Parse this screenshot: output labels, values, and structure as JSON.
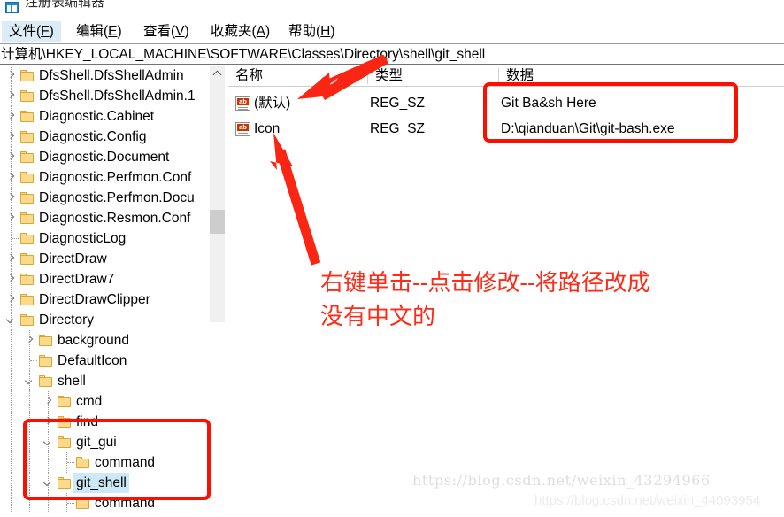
{
  "window": {
    "title": "注册表编辑器",
    "icon": "registry-editor-icon"
  },
  "menubar": {
    "items": [
      {
        "label": "文件(F)",
        "text": "文件(",
        "mnemonic": "F",
        "tail": ")",
        "active": true
      },
      {
        "label": "编辑(E)",
        "text": "编辑(",
        "mnemonic": "E",
        "tail": ")",
        "active": false
      },
      {
        "label": "查看(V)",
        "text": "查看(",
        "mnemonic": "V",
        "tail": ")",
        "active": false
      },
      {
        "label": "收藏夹(A)",
        "text": "收藏夹(",
        "mnemonic": "A",
        "tail": ")",
        "active": false
      },
      {
        "label": "帮助(H)",
        "text": "帮助(",
        "mnemonic": "H",
        "tail": ")",
        "active": false
      }
    ]
  },
  "address": {
    "path": "计算机\\HKEY_LOCAL_MACHINE\\SOFTWARE\\Classes\\Directory\\shell\\git_shell"
  },
  "tree": {
    "scrollbar": {
      "up_icon": "chevron-up-icon"
    },
    "items": [
      {
        "label": "DfsShell.DfsShellAdmin",
        "depth": 1,
        "state": "collapsed",
        "selected": false
      },
      {
        "label": "DfsShell.DfsShellAdmin.1",
        "depth": 1,
        "state": "collapsed",
        "selected": false
      },
      {
        "label": "Diagnostic.Cabinet",
        "depth": 1,
        "state": "collapsed",
        "selected": false
      },
      {
        "label": "Diagnostic.Config",
        "depth": 1,
        "state": "collapsed",
        "selected": false
      },
      {
        "label": "Diagnostic.Document",
        "depth": 1,
        "state": "collapsed",
        "selected": false
      },
      {
        "label": "Diagnostic.Perfmon.Conf",
        "depth": 1,
        "state": "collapsed",
        "selected": false
      },
      {
        "label": "Diagnostic.Perfmon.Docu",
        "depth": 1,
        "state": "collapsed",
        "selected": false
      },
      {
        "label": "Diagnostic.Resmon.Conf",
        "depth": 1,
        "state": "collapsed",
        "selected": false
      },
      {
        "label": "DiagnosticLog",
        "depth": 1,
        "state": "leaf",
        "selected": false
      },
      {
        "label": "DirectDraw",
        "depth": 1,
        "state": "collapsed",
        "selected": false
      },
      {
        "label": "DirectDraw7",
        "depth": 1,
        "state": "collapsed",
        "selected": false
      },
      {
        "label": "DirectDrawClipper",
        "depth": 1,
        "state": "collapsed",
        "selected": false
      },
      {
        "label": "Directory",
        "depth": 1,
        "state": "expanded",
        "selected": false
      },
      {
        "label": "background",
        "depth": 2,
        "state": "collapsed",
        "selected": false
      },
      {
        "label": "DefaultIcon",
        "depth": 2,
        "state": "leaf",
        "selected": false
      },
      {
        "label": "shell",
        "depth": 2,
        "state": "expanded",
        "selected": false
      },
      {
        "label": "cmd",
        "depth": 3,
        "state": "collapsed",
        "selected": false
      },
      {
        "label": "find",
        "depth": 3,
        "state": "collapsed",
        "selected": false
      },
      {
        "label": "git_gui",
        "depth": 3,
        "state": "expanded",
        "selected": false
      },
      {
        "label": "command",
        "depth": 4,
        "state": "leaf",
        "selected": false
      },
      {
        "label": "git_shell",
        "depth": 3,
        "state": "expanded",
        "selected": true
      },
      {
        "label": "command",
        "depth": 4,
        "state": "leaf",
        "selected": false
      }
    ]
  },
  "values": {
    "columns": [
      {
        "key": "name",
        "label": "名称"
      },
      {
        "key": "type",
        "label": "类型"
      },
      {
        "key": "data",
        "label": "数据"
      }
    ],
    "rows": [
      {
        "icon": "string-value-icon",
        "name": "(默认)",
        "type": "REG_SZ",
        "data": "Git Ba&sh Here"
      },
      {
        "icon": "string-value-icon",
        "name": "Icon",
        "type": "REG_SZ",
        "data": "D:\\qianduan\\Git\\git-bash.exe"
      }
    ]
  },
  "annotations": {
    "color": "#ff2b19",
    "box_color": "#fa0f00",
    "instruction": "右键单击--点击修改--将路径改成\n没有中文的",
    "arrow_to_default": "arrow-icon",
    "arrow_to_icon": "arrow-icon",
    "highlight_tree_keys": "git_gui / git_shell",
    "highlight_data_values": "data-column-values"
  },
  "watermarks": {
    "primary": "https://blog.csdn.net/weixin_43294966",
    "secondary": "https://blog.csdn.net/weixin_44093954"
  }
}
